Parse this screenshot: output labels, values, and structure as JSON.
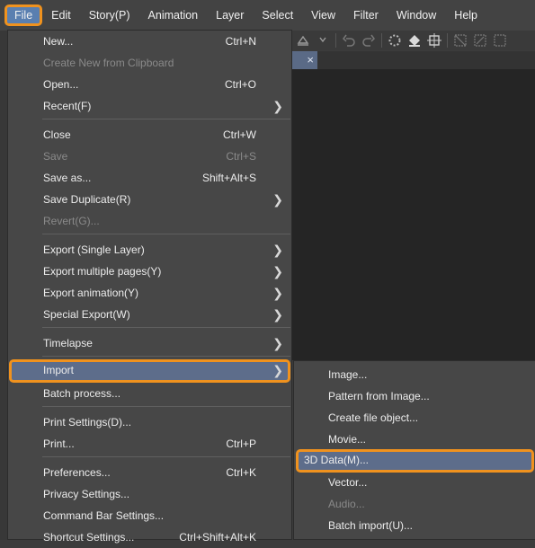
{
  "menubar": {
    "items": [
      "File",
      "Edit",
      "Story(P)",
      "Animation",
      "Layer",
      "Select",
      "View",
      "Filter",
      "Window",
      "Help"
    ]
  },
  "canvas_tab": {
    "close_glyph": "×"
  },
  "file_menu": {
    "items": [
      {
        "label": "New...",
        "shortcut": "Ctrl+N"
      },
      {
        "label": "Create New from Clipboard",
        "shortcut": "",
        "disabled": true
      },
      {
        "label": "Open...",
        "shortcut": "Ctrl+O"
      },
      {
        "label": "Recent(F)",
        "shortcut": "",
        "submenu": true
      },
      {
        "label": "Close",
        "shortcut": "Ctrl+W"
      },
      {
        "label": "Save",
        "shortcut": "Ctrl+S",
        "disabled": true
      },
      {
        "label": "Save as...",
        "shortcut": "Shift+Alt+S"
      },
      {
        "label": "Save Duplicate(R)",
        "shortcut": "",
        "submenu": true
      },
      {
        "label": "Revert(G)...",
        "shortcut": "",
        "disabled": true
      },
      {
        "label": "Export (Single Layer)",
        "shortcut": "",
        "submenu": true
      },
      {
        "label": "Export multiple pages(Y)",
        "shortcut": "",
        "submenu": true
      },
      {
        "label": "Export animation(Y)",
        "shortcut": "",
        "submenu": true
      },
      {
        "label": "Special Export(W)",
        "shortcut": "",
        "submenu": true
      },
      {
        "label": "Timelapse",
        "shortcut": "",
        "submenu": true
      },
      {
        "label": "Import",
        "shortcut": "",
        "submenu": true,
        "highlighted": true
      },
      {
        "label": "Batch process...",
        "shortcut": ""
      },
      {
        "label": "Print Settings(D)...",
        "shortcut": ""
      },
      {
        "label": "Print...",
        "shortcut": "Ctrl+P"
      },
      {
        "label": "Preferences...",
        "shortcut": "Ctrl+K"
      },
      {
        "label": "Privacy Settings...",
        "shortcut": ""
      },
      {
        "label": "Command Bar Settings...",
        "shortcut": ""
      },
      {
        "label": "Shortcut Settings...",
        "shortcut": "Ctrl+Shift+Alt+K"
      }
    ]
  },
  "import_submenu": {
    "items": [
      {
        "label": "Image..."
      },
      {
        "label": "Pattern from Image..."
      },
      {
        "label": "Create file object..."
      },
      {
        "label": "Movie..."
      },
      {
        "label": "3D Data(M)...",
        "highlighted": true
      },
      {
        "label": "Vector..."
      },
      {
        "label": "Audio...",
        "disabled": true
      },
      {
        "label": "Batch import(U)..."
      }
    ]
  },
  "colors": {
    "highlight_outline": "#f0921e",
    "selection_bg": "#5d6d8b",
    "menu_bg": "#474747"
  }
}
